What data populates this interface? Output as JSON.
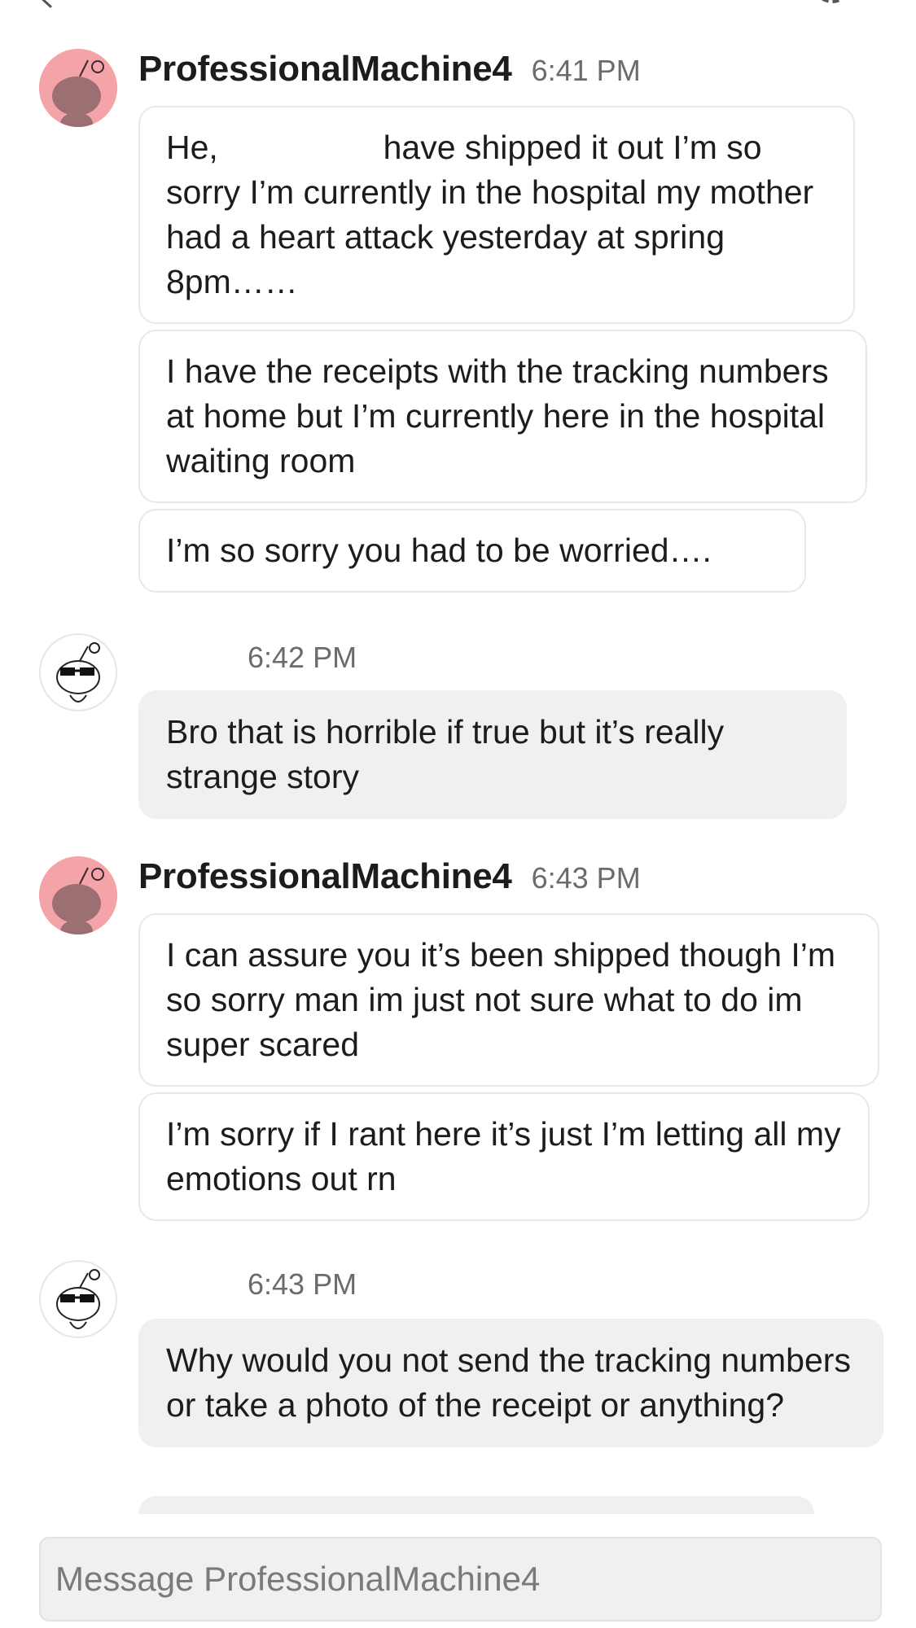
{
  "conversation": {
    "groups": [
      {
        "sender": "ProfessionalMachine4",
        "time": "6:41 PM",
        "messages": [
          {
            "pre": "He,",
            "post": "have shipped it out I’m so sorry I’m currently in the hospital my mother had a heart attack yesterday at spring 8pm……"
          },
          {
            "text": "I have the receipts with the tracking numbers at home but I’m currently here in the hospital waiting room"
          },
          {
            "text": "I’m so sorry you had to be worried…."
          }
        ]
      },
      {
        "sender": "",
        "time": "6:42 PM",
        "messages": [
          {
            "text": "Bro that is horrible if true but it’s really strange story"
          }
        ]
      },
      {
        "sender": "ProfessionalMachine4",
        "time": "6:43 PM",
        "messages": [
          {
            "text": "I can assure you it’s been shipped though I’m so sorry man im just not sure what to do im super scared"
          },
          {
            "text": "I’m sorry if I rant here it’s just I’m letting all my emotions out rn"
          }
        ]
      },
      {
        "sender": "",
        "time": "6:43 PM",
        "messages": [
          {
            "text": "Why would you not send the tracking numbers or take a photo of the receipt or anything?"
          }
        ]
      }
    ]
  },
  "composer": {
    "placeholder": "Message ProfessionalMachine4"
  },
  "colors": {
    "pink_avatar": "#f4a3a8",
    "bubble_fill": "#f0f0f2",
    "bubble_border": "#e8e8ea"
  },
  "icons": {
    "back": "chevron-left-icon",
    "settings": "gear-icon",
    "avatar_other": "snoo-avatar-icon",
    "avatar_self": "snoo-sunglasses-avatar-icon"
  }
}
